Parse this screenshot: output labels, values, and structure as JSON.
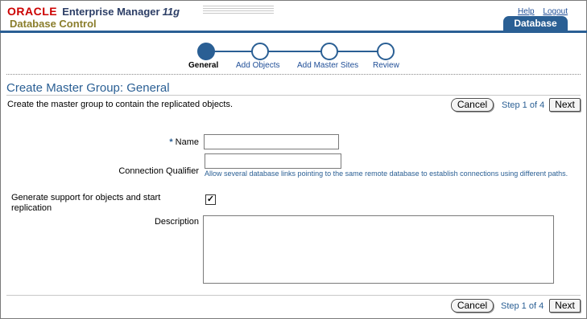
{
  "branding": {
    "oracle": "ORACLE",
    "product": "Enterprise Manager",
    "version": "11g",
    "subtitle": "Database Control"
  },
  "global_links": {
    "help": "Help",
    "logout": "Logout"
  },
  "tab": {
    "label": "Database"
  },
  "train": {
    "steps": [
      "General",
      "Add Objects",
      "Add Master Sites",
      "Review"
    ],
    "current_index": 0
  },
  "page": {
    "title": "Create Master Group: General",
    "instruction": "Create the master group to contain the replicated objects."
  },
  "actions": {
    "cancel": "Cancel",
    "step": "Step 1 of 4",
    "next": "Next"
  },
  "form": {
    "required_marker": "*",
    "name_label": "Name",
    "name_value": "",
    "qualifier_label": "Connection Qualifier",
    "qualifier_value": "",
    "qualifier_hint": "Allow several database links pointing to the same remote database to establish connections using different paths.",
    "generate_label": "Generate support for objects and start replication",
    "generate_checked": true,
    "description_label": "Description",
    "description_value": ""
  },
  "colors": {
    "accent": "#2a5f94",
    "brand_red": "#cc0000",
    "subtitle": "#8a7d2b"
  }
}
